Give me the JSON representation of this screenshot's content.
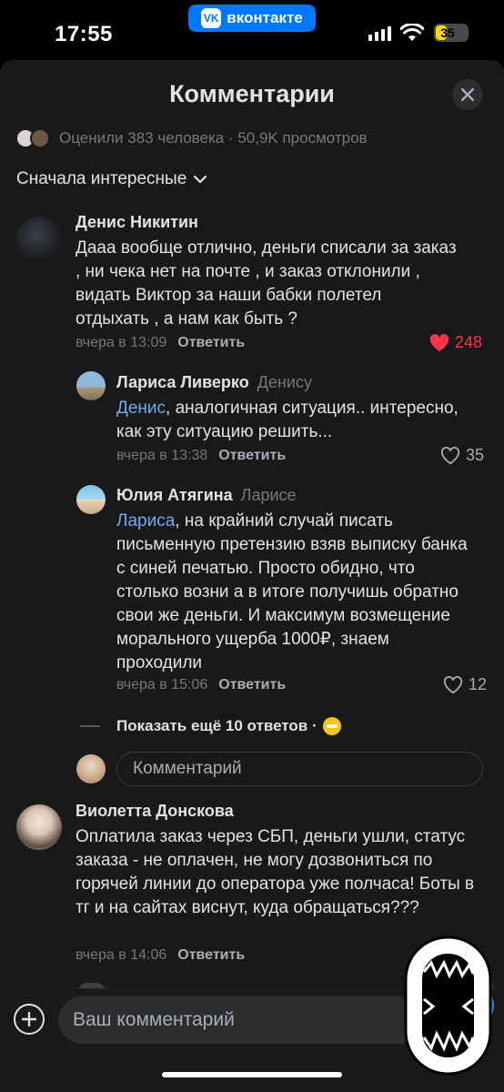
{
  "status_bar": {
    "time": "17:55",
    "app_pill": "вконтакте",
    "app_logo": "VK",
    "battery": "35",
    "battery_level": 0.35,
    "icons": [
      "signal-icon",
      "wifi-icon",
      "battery-icon"
    ]
  },
  "header": {
    "title": "Комментарии",
    "close_icon": "close-icon"
  },
  "stats": {
    "text": "Оценили 383 человека · 50,9K просмотров"
  },
  "sort": {
    "label": "Сначала интересные"
  },
  "comments": [
    {
      "author": "Денис Никитин",
      "reply_to": "",
      "mention": "",
      "text": "Дааа вообще отлично, деньги списали за заказ , ни чека нет на почте , и заказ отклонили , видать Виктор за наши бабки полетел отдыхать , а нам как быть ?",
      "time": "вчера в 13:09",
      "reply_label": "Ответить",
      "likes": "248",
      "liked": true
    },
    {
      "author": "Лариса Ливерко",
      "reply_to": "Денису",
      "mention": "Денис",
      "text": ", аналогичная ситуация.. интересно, как эту ситуацию решить...",
      "time": "вчера в 13:38",
      "reply_label": "Ответить",
      "likes": "35",
      "liked": false
    },
    {
      "author": "Юлия Атягина",
      "reply_to": "Ларисе",
      "mention": "Лариса",
      "text": ", на крайний случай писать письменную претензию взяв выписку банка с синей печатью. Просто обидно, что столько возни а в итоге получишь обратно свои же деньги. И максимум возмещение морального ущерба 1000₽, знаем проходили",
      "time": "вчера в 15:06",
      "reply_label": "Ответить",
      "likes": "12",
      "liked": false
    },
    {
      "author": "Виолетта Донскова",
      "reply_to": "",
      "mention": "",
      "text": "Оплатила заказ через СБП, деньги ушли, статус заказа - не оплачен, не могу дозвониться по горячей линии до оператора уже полчаса! Боты в тг и на сайтах виснут, куда обращаться???",
      "time": "вчера в 14:06",
      "reply_label": "Ответить",
      "likes": "",
      "liked": false
    }
  ],
  "show_more": {
    "label": "Показать ещё 10 ответов ·"
  },
  "inline_reply": {
    "placeholder": "Комментарий"
  },
  "composer": {
    "placeholder": "Ваш комментарий"
  },
  "colors": {
    "background": "#19191a",
    "accent": "#71aaeb",
    "like_red": "#ff3347",
    "vk_blue": "#0077ff"
  }
}
